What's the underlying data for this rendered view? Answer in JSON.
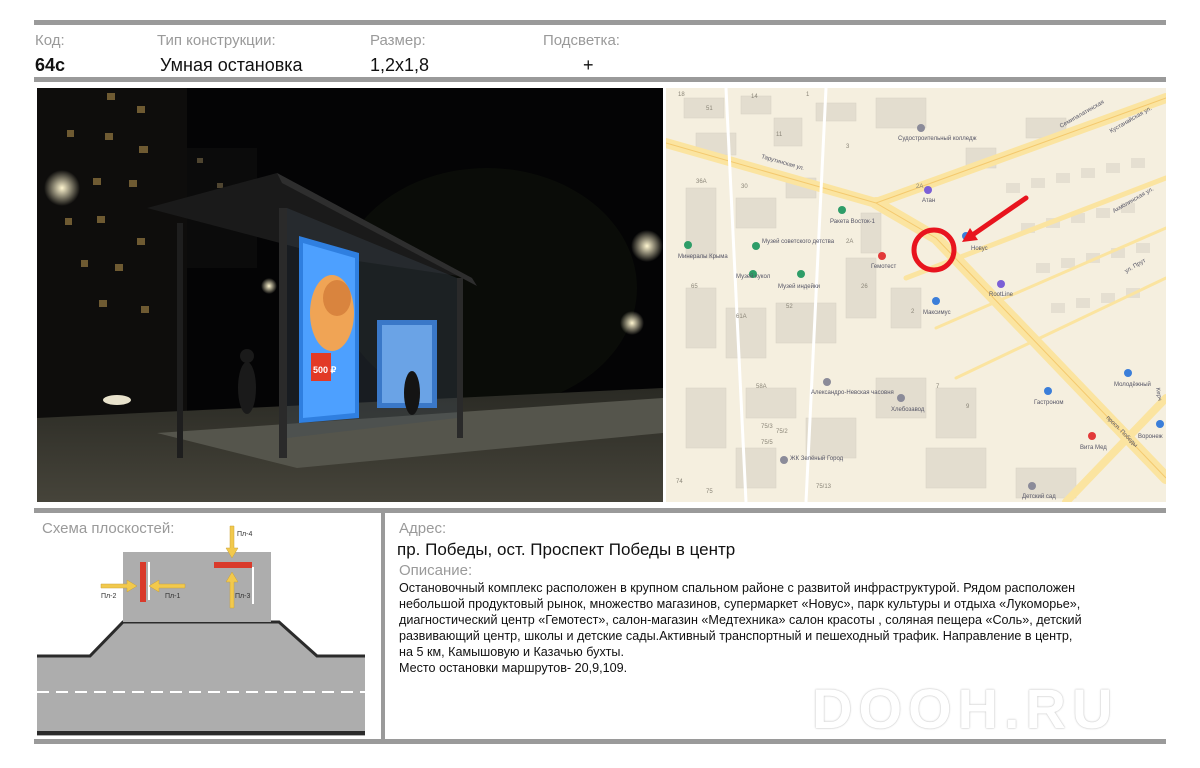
{
  "header": {
    "code": {
      "label": "Код:",
      "value": "64с"
    },
    "type": {
      "label": "Тип конструкции:",
      "value": "Умная остановка"
    },
    "size": {
      "label": "Размер:",
      "value": "1,2х1,8"
    },
    "light": {
      "label": "Подсветка:",
      "value": "+"
    }
  },
  "poster": {
    "line1": "500 ₽"
  },
  "map": {
    "streets": {
      "tarutinskaya": "Тарутинская ул.",
      "pobedy": "просп. Победы",
      "semipalatinskaya": "Семипалатинская",
      "kustanaiskaya": "Кустанайская ул.",
      "akmolinskaya": "Акмолинская ул.",
      "prut": "ул. Прут",
      "kerch": "Керч"
    },
    "pois": {
      "sudostroit": "Судостроительный колледж",
      "atan": "Атан",
      "raketa": "Ракета Восток-1",
      "muzey_sov": "Музей советского детства",
      "minerals": "Минералы Крыма",
      "muzey_kukol": "Музей кукол",
      "muzey_indeyki": "Музей индейки",
      "gemotest": "Гемотест",
      "maksimus": "Максимус",
      "rootline": "RootLine",
      "novus": "Новус",
      "alex_nevsky": "Александро-Невская часовня",
      "hlebozavod": "Хлебозавод",
      "gastronom": "Гастроном",
      "molodezhny": "Молодёжный",
      "vita_med": "Вита Мед",
      "voronezh": "Воронеж",
      "zk_zeleny": "ЖК Зелёный Город",
      "det_sad": "Детский сад"
    },
    "houses": [
      "18",
      "51",
      "14",
      "1",
      "36А",
      "30",
      "11",
      "2А",
      "3",
      "65",
      "2А",
      "26",
      "52",
      "61А",
      "2",
      "7",
      "9",
      "58А",
      "75/3",
      "75/5",
      "75/2",
      "75/13",
      "74",
      "75"
    ],
    "colors": {
      "marker": "#e8141e",
      "road": "#fbe7a6",
      "building": "#e2ddd0"
    }
  },
  "scheme": {
    "title": "Схема плоскостей:",
    "planes": [
      "Пл-1",
      "Пл-2",
      "Пл-3",
      "Пл-4"
    ],
    "colors": {
      "plane": "#d93a2b",
      "arrow": "#f2c94c",
      "road": "#adadad",
      "curb": "#2b2b2b"
    }
  },
  "address": {
    "label": "Адрес:",
    "value": "пр. Победы, ост. Проспект Победы в центр"
  },
  "description": {
    "label": "Описание:",
    "lines": [
      "Остановочный комплекс расположен в крупном спальном районе с развитой инфраструктурой. Рядом расположен",
      "небольшой продуктовый рынок, множество магазинов, супермаркет «Новус», парк культуры и отдыха «Лукоморье»,",
      "диагностический центр «Гемотест», салон-магазин «Медтехника» салон красоты , соляная пещера «Соль», детский",
      "развивающий центр, школы и детские сады.Активный транспортный и пешеходный трафик. Направление в центр,",
      "на 5 км, Камышовую и Казачью бухты.",
      "Место остановки маршрутов- 20,9,109."
    ]
  },
  "watermark": "DOOH.RU"
}
